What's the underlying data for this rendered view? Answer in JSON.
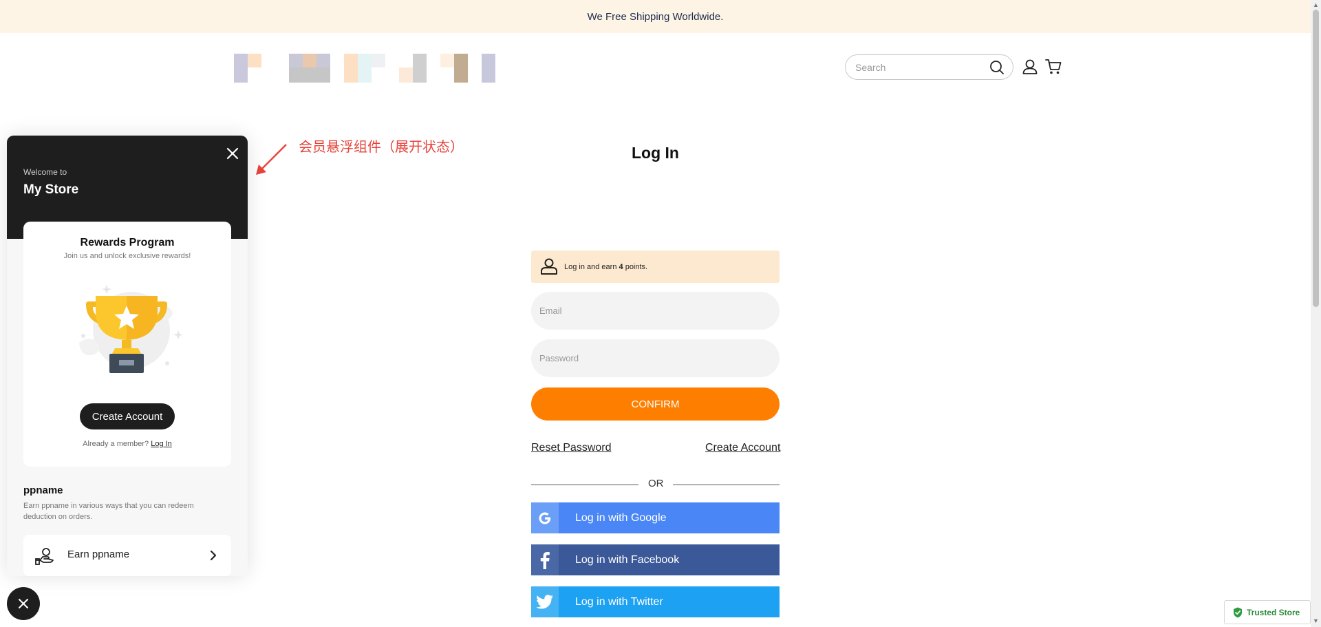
{
  "announcement": "We Free Shipping Worldwide.",
  "search": {
    "placeholder": "Search"
  },
  "annotation": "会员悬浮组件（展开状态）",
  "login": {
    "title": "Log In",
    "points_prefix": "Log in and earn ",
    "points_value": "4",
    "points_suffix": " points.",
    "email_placeholder": "Email",
    "password_placeholder": "Password",
    "confirm_label": "CONFIRM",
    "reset_password": "Reset Password",
    "create_account": "Create Account",
    "or": "OR",
    "social": [
      {
        "label": "Log in with Google",
        "color": "#4a86f5",
        "icon_bg": "#6b9ef7",
        "icon": "google-icon"
      },
      {
        "label": "Log in with Facebook",
        "color": "#3b5998",
        "icon_bg": "#4a67a6",
        "icon": "facebook-icon"
      },
      {
        "label": "Log in with Twitter",
        "color": "#1da1f2",
        "icon_bg": "#45b2f4",
        "icon": "twitter-icon"
      }
    ]
  },
  "widget": {
    "welcome": "Welcome to",
    "store_name": "My Store",
    "card_title": "Rewards Program",
    "card_subtitle": "Join us and unlock exclusive rewards!",
    "create_account": "Create Account",
    "already_member": "Already a member? ",
    "log_in": "Log In",
    "points_name": "ppname",
    "points_desc": "Earn ppname in various ways that you can redeem deduction on orders.",
    "earn_label": "Earn ppname"
  },
  "trusted_store": "Trusted Store",
  "colors": {
    "accent": "#fe7f00",
    "dark": "#1e1e1e",
    "announce_bg": "#fdf4e6"
  }
}
